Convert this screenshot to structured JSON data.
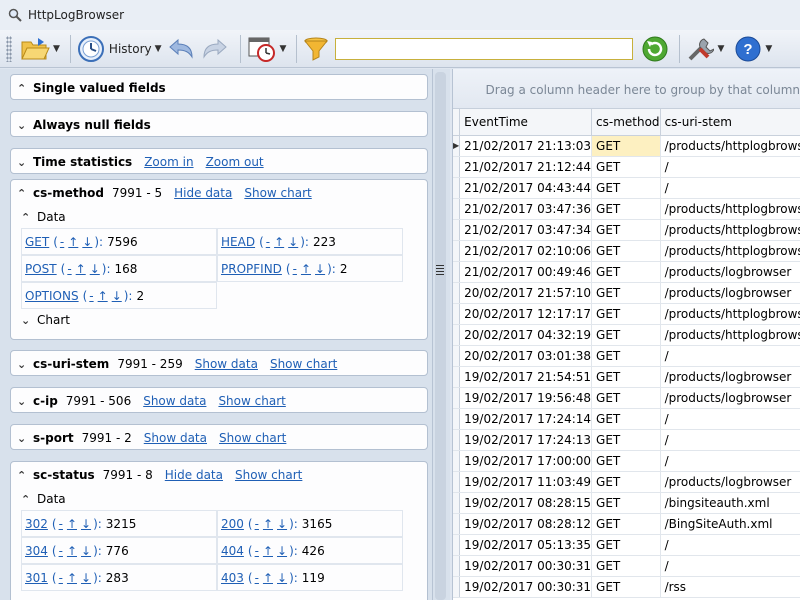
{
  "window": {
    "title": "HttpLogBrowser"
  },
  "toolbar": {
    "history_label": "History",
    "search_value": "",
    "search_placeholder": ""
  },
  "left_panels": {
    "single_valued": {
      "title": "Single valued fields"
    },
    "always_null": {
      "title": "Always null fields"
    },
    "time_stats": {
      "title": "Time statistics",
      "zoom_in": "Zoom in",
      "zoom_out": "Zoom out"
    },
    "cs_method": {
      "title": "cs-method",
      "counts": "7991 - 5",
      "hide_data": "Hide data",
      "show_chart": "Show chart",
      "data_label": "Data",
      "chart_label": "Chart",
      "items": [
        {
          "key": "GET",
          "count": "7596"
        },
        {
          "key": "HEAD",
          "count": "223"
        },
        {
          "key": "POST",
          "count": "168"
        },
        {
          "key": "PROPFIND",
          "count": "2"
        },
        {
          "key": "OPTIONS",
          "count": "2"
        }
      ]
    },
    "cs_uri_stem": {
      "title": "cs-uri-stem",
      "counts": "7991 - 259",
      "show_data": "Show data",
      "show_chart": "Show chart"
    },
    "c_ip": {
      "title": "c-ip",
      "counts": "7991 - 506",
      "show_data": "Show data",
      "show_chart": "Show chart"
    },
    "s_port": {
      "title": "s-port",
      "counts": "7991 - 2",
      "show_data": "Show data",
      "show_chart": "Show chart"
    },
    "sc_status": {
      "title": "sc-status",
      "counts": "7991 - 8",
      "hide_data": "Hide data",
      "show_chart": "Show chart",
      "data_label": "Data",
      "items": [
        {
          "key": "302",
          "count": "3215"
        },
        {
          "key": "200",
          "count": "3165"
        },
        {
          "key": "304",
          "count": "776"
        },
        {
          "key": "404",
          "count": "426"
        },
        {
          "key": "301",
          "count": "283"
        },
        {
          "key": "403",
          "count": "119"
        }
      ]
    },
    "ops": {
      "minus": "-",
      "up": "↑",
      "down": "↓"
    }
  },
  "grid": {
    "group_hint": "Drag a column header here to group by that column",
    "columns": [
      "EventTime",
      "cs-method",
      "cs-uri-stem"
    ],
    "rows": [
      [
        "21/02/2017 21:13:03",
        "GET",
        "/products/httplogbrowser"
      ],
      [
        "21/02/2017 21:12:44",
        "GET",
        "/"
      ],
      [
        "21/02/2017 04:43:44",
        "GET",
        "/"
      ],
      [
        "21/02/2017 03:47:36",
        "GET",
        "/products/httplogbrowser"
      ],
      [
        "21/02/2017 03:47:34",
        "GET",
        "/products/httplogbrowser"
      ],
      [
        "21/02/2017 02:10:06",
        "GET",
        "/products/httplogbrowser"
      ],
      [
        "21/02/2017 00:49:46",
        "GET",
        "/products/logbrowser"
      ],
      [
        "20/02/2017 21:57:10",
        "GET",
        "/products/logbrowser"
      ],
      [
        "20/02/2017 12:17:17",
        "GET",
        "/products/httplogbrowser"
      ],
      [
        "20/02/2017 04:32:19",
        "GET",
        "/products/httplogbrowser"
      ],
      [
        "20/02/2017 03:01:38",
        "GET",
        "/"
      ],
      [
        "19/02/2017 21:54:51",
        "GET",
        "/products/logbrowser"
      ],
      [
        "19/02/2017 19:56:48",
        "GET",
        "/products/logbrowser"
      ],
      [
        "19/02/2017 17:24:14",
        "GET",
        "/"
      ],
      [
        "19/02/2017 17:24:13",
        "GET",
        "/"
      ],
      [
        "19/02/2017 17:00:00",
        "GET",
        "/"
      ],
      [
        "19/02/2017 11:03:49",
        "GET",
        "/products/logbrowser"
      ],
      [
        "19/02/2017 08:28:15",
        "GET",
        "/bingsiteauth.xml"
      ],
      [
        "19/02/2017 08:28:12",
        "GET",
        "/BingSiteAuth.xml"
      ],
      [
        "19/02/2017 05:13:35",
        "GET",
        "/"
      ],
      [
        "19/02/2017 00:30:31",
        "GET",
        "/"
      ],
      [
        "19/02/2017 00:30:31",
        "GET",
        "/rss"
      ]
    ]
  }
}
